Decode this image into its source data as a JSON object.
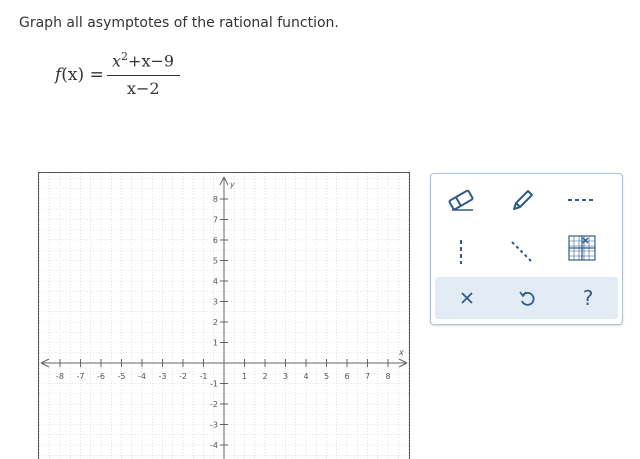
{
  "prompt": "Graph all asymptotes of the rational function.",
  "function": {
    "lhs_name": "f",
    "lhs_arg": "(x)",
    "equals": "=",
    "numerator_base": "x",
    "numerator_exp": "2",
    "numerator_rest": "+x−9",
    "denominator": "x−2"
  },
  "graph": {
    "x_axis_label": "x",
    "y_axis_label": "y",
    "x_ticks": [
      "-8",
      "-7",
      "-6",
      "-5",
      "-4",
      "-3",
      "-2",
      "-1",
      "1",
      "2",
      "3",
      "4",
      "5",
      "6",
      "7",
      "8"
    ],
    "y_ticks": [
      "8",
      "7",
      "6",
      "5",
      "4",
      "3",
      "2",
      "1",
      "-1",
      "-2",
      "-3",
      "-4"
    ],
    "x_range": [
      -8,
      8
    ],
    "y_range_visible": [
      -4,
      8
    ],
    "grid": true
  },
  "palette": {
    "tools": [
      {
        "name": "eraser-icon",
        "label": "Erase"
      },
      {
        "name": "pencil-icon",
        "label": "Draw"
      },
      {
        "name": "horizontal-dashed-line-icon",
        "label": "Horizontal asymptote"
      },
      {
        "name": "vertical-dashed-line-icon",
        "label": "Vertical asymptote"
      },
      {
        "name": "slant-dashed-line-icon",
        "label": "Slant asymptote"
      },
      {
        "name": "grid-icon",
        "label": "Grid"
      }
    ],
    "actions": [
      {
        "name": "clear-icon",
        "glyph": "×"
      },
      {
        "name": "undo-icon",
        "glyph": "↺"
      },
      {
        "name": "help-icon",
        "glyph": "?"
      }
    ],
    "colors": {
      "border": "#a9c4e0",
      "bottom_bg": "#e3ecf4",
      "icon": "#2f5d8a"
    }
  }
}
